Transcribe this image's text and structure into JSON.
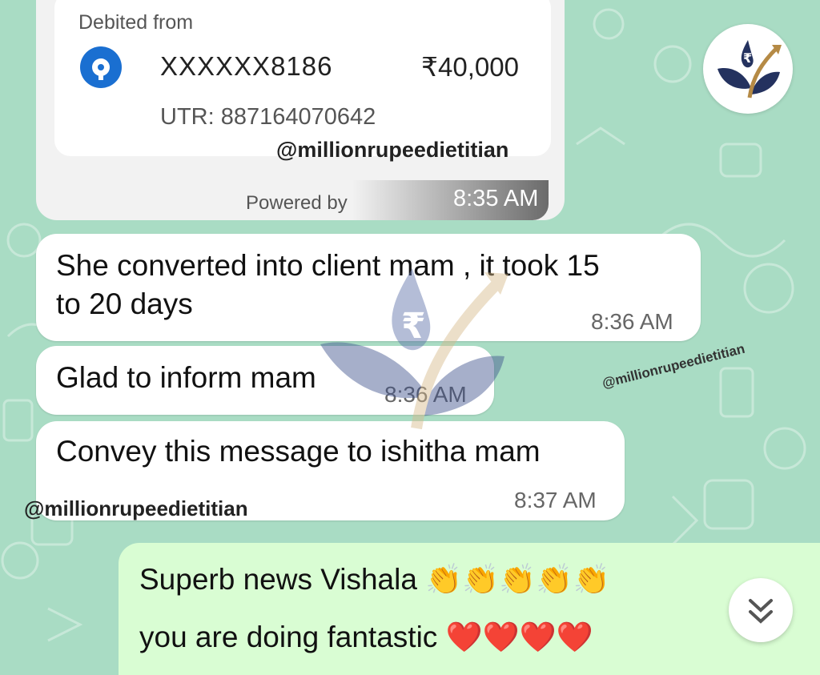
{
  "payment": {
    "debited_from_label": "Debited from",
    "account": "XXXXXX8186",
    "amount": "₹40,000",
    "utr": "UTR: 887164070642",
    "powered_by": "Powered by",
    "time": "8:35 AM"
  },
  "watermarks": {
    "top": "@millionrupeedietitian",
    "middle_right": "@millionrupeedietitian",
    "bottom_left": "@millionrupeedietitian"
  },
  "messages": [
    {
      "line1": "She converted into client mam , it took 15",
      "line2": "to 20 days",
      "time": "8:36 AM"
    },
    {
      "text": "Glad to inform mam",
      "time": "8:36 AM"
    },
    {
      "text": "Convey this message to ishitha mam",
      "time": "8:37 AM"
    }
  ],
  "reply": {
    "line1": "Superb news Vishala",
    "line1_emoji": "👏👏👏👏👏",
    "line2": "you are doing fantastic",
    "line2_emoji": "❤️❤️❤️❤️"
  },
  "colors": {
    "background": "#a9dcc4",
    "bubble": "#ffffff",
    "outgoing": "#d9fdd3",
    "bank_blue": "#1a6fd1",
    "logo_navy": "#24325f",
    "logo_gold": "#b58a45"
  },
  "icons": {
    "bank": "bank-logo-icon",
    "scroll_down": "double-chevron-down-icon",
    "brand": "rupee-leaf-logo-icon"
  }
}
